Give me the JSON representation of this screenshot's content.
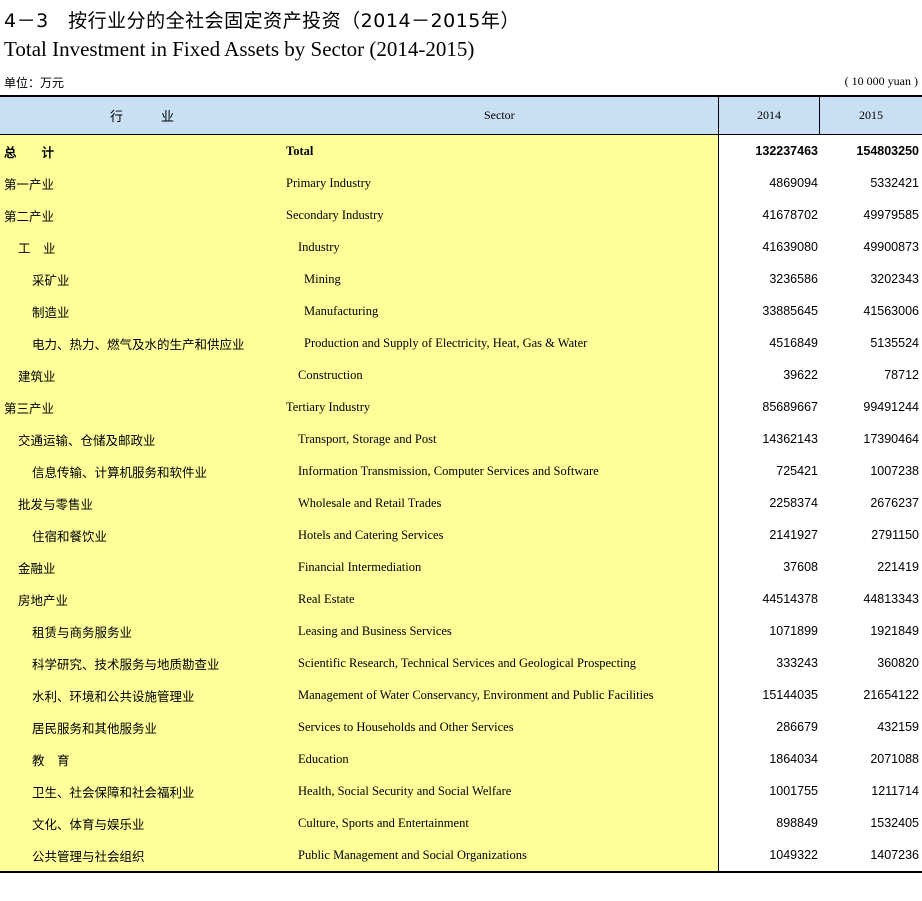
{
  "title": {
    "cn": "4－3　按行业分的全社会固定资产投资（2014－2015年）",
    "en": "Total Investment in Fixed Assets by Sector (2014-2015)"
  },
  "unit": {
    "cn": "单位：万元",
    "en": "( 10 000 yuan )"
  },
  "header": {
    "cn": "行业",
    "en": "Sector",
    "y1": "2014",
    "y2": "2015"
  },
  "rows": [
    {
      "cn": "总　　计",
      "en": "Total",
      "v2014": "132237463",
      "v2015": "154803250",
      "level": 0,
      "bold": true
    },
    {
      "cn": "第一产业",
      "en": "Primary Industry",
      "v2014": "4869094",
      "v2015": "5332421",
      "level": 0
    },
    {
      "cn": "第二产业",
      "en": "Secondary Industry",
      "v2014": "41678702",
      "v2015": "49979585",
      "level": 0
    },
    {
      "cn": "工　业",
      "en": "Industry",
      "v2014": "41639080",
      "v2015": "49900873",
      "level": 1
    },
    {
      "cn": "采矿业",
      "en": "Mining",
      "v2014": "3236586",
      "v2015": "3202343",
      "level": 2
    },
    {
      "cn": "制造业",
      "en": "Manufacturing",
      "v2014": "33885645",
      "v2015": "41563006",
      "level": 2
    },
    {
      "cn": "电力、热力、燃气及水的生产和供应业",
      "en": "Production and Supply of Electricity, Heat, Gas & Water",
      "v2014": "4516849",
      "v2015": "5135524",
      "level": 2
    },
    {
      "cn": "建筑业",
      "en": "Construction",
      "v2014": "39622",
      "v2015": "78712",
      "level": 1
    },
    {
      "cn": "第三产业",
      "en": "Tertiary Industry",
      "v2014": "85689667",
      "v2015": "99491244",
      "level": 0
    },
    {
      "cn": "交通运输、仓储及邮政业",
      "en": "Transport, Storage and Post",
      "v2014": "14362143",
      "v2015": "17390464",
      "level": 1
    },
    {
      "cn": "信息传输、计算机服务和软件业",
      "en": "Information Transmission, Computer Services and Software",
      "v2014": "725421",
      "v2015": "1007238",
      "level": 3
    },
    {
      "cn": "批发与零售业",
      "en": "Wholesale and Retail Trades",
      "v2014": "2258374",
      "v2015": "2676237",
      "level": 1
    },
    {
      "cn": "住宿和餐饮业",
      "en": "Hotels and Catering Services",
      "v2014": "2141927",
      "v2015": "2791150",
      "level": 3
    },
    {
      "cn": "金融业",
      "en": "Financial Intermediation",
      "v2014": "37608",
      "v2015": "221419",
      "level": 1
    },
    {
      "cn": "房地产业",
      "en": "Real Estate",
      "v2014": "44514378",
      "v2015": "44813343",
      "level": 1
    },
    {
      "cn": "租赁与商务服务业",
      "en": "Leasing and Business Services",
      "v2014": "1071899",
      "v2015": "1921849",
      "level": 3
    },
    {
      "cn": "科学研究、技术服务与地质勘查业",
      "en": "Scientific Research, Technical Services and Geological Prospecting",
      "v2014": "333243",
      "v2015": "360820",
      "level": 3
    },
    {
      "cn": "水利、环境和公共设施管理业",
      "en": "Management of Water Conservancy, Environment and Public Facilities",
      "v2014": "15144035",
      "v2015": "21654122",
      "level": 3
    },
    {
      "cn": "居民服务和其他服务业",
      "en": "Services to Households and Other Services",
      "v2014": "286679",
      "v2015": "432159",
      "level": 3
    },
    {
      "cn": "教　育",
      "en": "Education",
      "v2014": "1864034",
      "v2015": "2071088",
      "level": 3
    },
    {
      "cn": "卫生、社会保障和社会福利业",
      "en": "Health, Social Security and Social Welfare",
      "v2014": "1001755",
      "v2015": "1211714",
      "level": 3
    },
    {
      "cn": "文化、体育与娱乐业",
      "en": "Culture, Sports and Entertainment",
      "v2014": "898849",
      "v2015": "1532405",
      "level": 3
    },
    {
      "cn": "公共管理与社会组织",
      "en": "Public Management and Social Organizations",
      "v2014": "1049322",
      "v2015": "1407236",
      "level": 3
    }
  ]
}
